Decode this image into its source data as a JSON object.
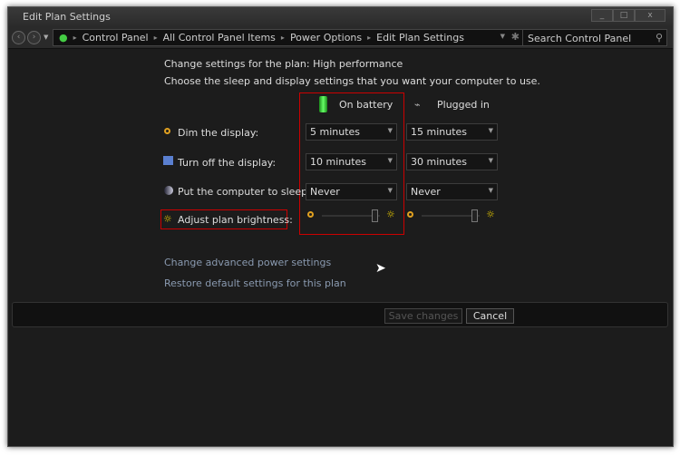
{
  "window": {
    "title": "Edit Plan Settings",
    "min": "_",
    "max": "□",
    "close": "x"
  },
  "nav": {
    "breadcrumb": [
      "Control Panel",
      "All Control Panel Items",
      "Power Options",
      "Edit Plan Settings"
    ],
    "search_placeholder": "Search Control Panel"
  },
  "main": {
    "heading": "Change settings for the plan: High performance",
    "subheading": "Choose the sleep and display settings that you want your computer to use.",
    "columns": [
      "On battery",
      "Plugged in"
    ],
    "rows": [
      {
        "label": "Dim the display:",
        "on_battery": "5 minutes",
        "plugged_in": "15 minutes",
        "icon": "dim-icon"
      },
      {
        "label": "Turn off the display:",
        "on_battery": "10 minutes",
        "plugged_in": "30 minutes",
        "icon": "display-off-icon"
      },
      {
        "label": "Put the computer to sleep:",
        "on_battery": "Never",
        "plugged_in": "Never",
        "icon": "sleep-moon-icon"
      }
    ],
    "brightness": {
      "label": "Adjust plan brightness:",
      "on_battery_level": 0.9,
      "plugged_in_level": 0.9
    },
    "links": [
      "Change advanced power settings",
      "Restore default settings for this plan"
    ]
  },
  "footer": {
    "save": "Save changes",
    "cancel": "Cancel"
  },
  "colors": {
    "highlight": "#cc0000",
    "battery": "#3cc43c"
  }
}
